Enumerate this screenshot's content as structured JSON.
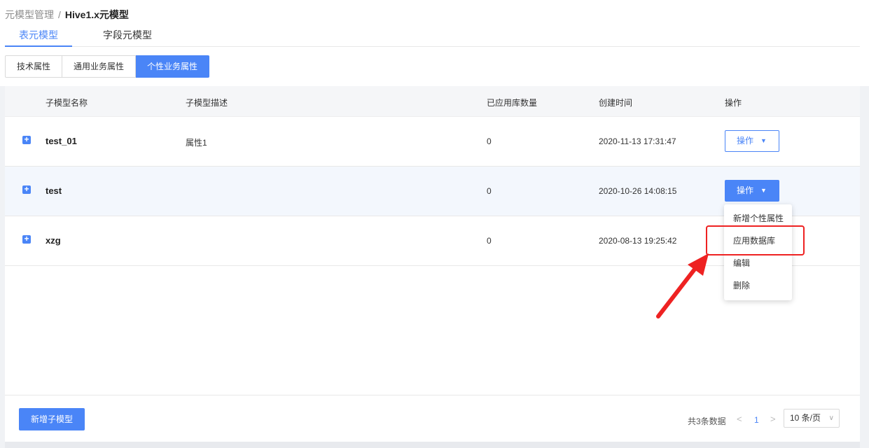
{
  "breadcrumb": {
    "parent": "元模型管理",
    "separator": "/",
    "current": "Hive1.x元模型"
  },
  "tabs": [
    {
      "label": "表元模型",
      "active": true
    },
    {
      "label": "字段元模型",
      "active": false
    }
  ],
  "segments": [
    {
      "label": "技术属性"
    },
    {
      "label": "通用业务属性"
    },
    {
      "label": "个性业务属性",
      "active": true
    }
  ],
  "table": {
    "headers": {
      "name": "子模型名称",
      "desc": "子模型描述",
      "count": "已应用库数量",
      "created": "创建时间",
      "ops": "操作"
    },
    "rows": [
      {
        "name": "test_01",
        "desc": "属性1",
        "count": "0",
        "created": "2020-11-13 17:31:47",
        "op_label": "操作"
      },
      {
        "name": "test",
        "desc": "",
        "count": "0",
        "created": "2020-10-26 14:08:15",
        "op_label": "操作"
      },
      {
        "name": "xzg",
        "desc": "",
        "count": "0",
        "created": "2020-08-13 19:25:42"
      }
    ]
  },
  "dropdown": {
    "items": [
      "新增个性属性",
      "应用数据库",
      "编辑",
      "删除"
    ],
    "highlighted": "应用数据库"
  },
  "footer": {
    "add_label": "新增子模型",
    "total": "共3条数据",
    "page": "1",
    "page_size": "10 条/页"
  },
  "colors": {
    "accent": "#4a85f7",
    "highlight": "#ee2222"
  },
  "icons": {
    "expand": "plus-square-icon",
    "caret": "caret-down-icon",
    "prev": "chevron-left-icon",
    "next": "chevron-right-icon",
    "arrow": "red-arrow-annotation"
  }
}
